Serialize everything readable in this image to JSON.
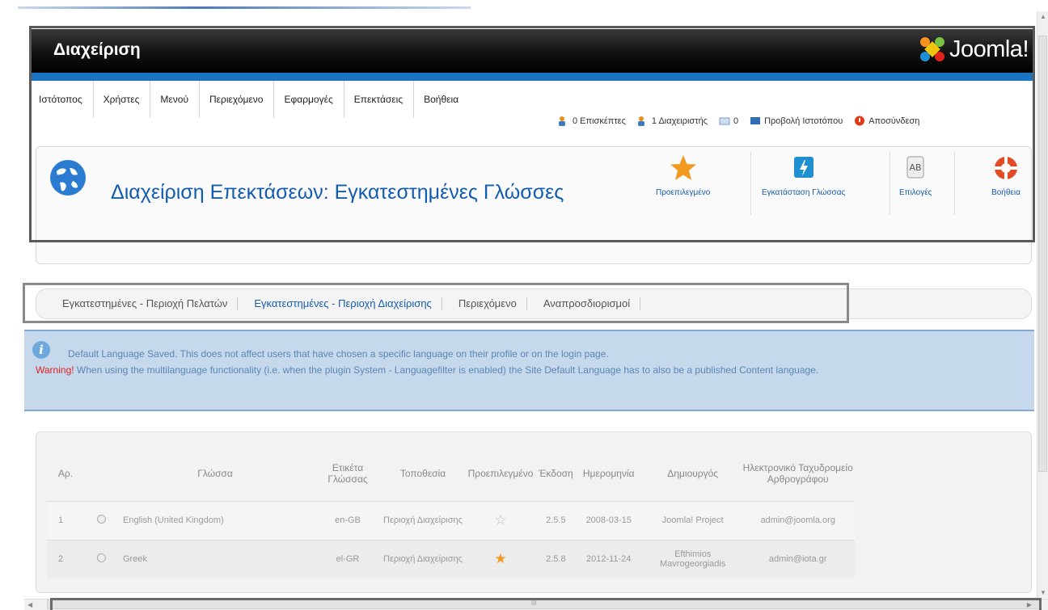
{
  "header": {
    "title": "Διαχείριση",
    "logo_text": "Joomla!"
  },
  "menu": {
    "items": [
      "Ιστότοπος",
      "Χρήστες",
      "Μενού",
      "Περιεχόμενο",
      "Εφαρμογές",
      "Επεκτάσεις",
      "Βοήθεια"
    ]
  },
  "status": {
    "visitors": "0 Επισκέπτες",
    "admins": "1 Διαχειριστής",
    "messages": "0",
    "view_site": "Προβολή Ιστοτόπου",
    "logout": "Αποσύνδεση"
  },
  "page": {
    "title": "Διαχείριση Επεκτάσεων: Εγκατεστημένες Γλώσσες"
  },
  "toolbar": {
    "default": "Προεπιλεγμένο",
    "install_language": "Εγκατάσταση Γλώσσας",
    "options": "Επιλογές",
    "help": "Βοήθεια"
  },
  "subtabs": {
    "items": [
      "Εγκατεστημένες - Περιοχή Πελατών",
      "Εγκατεστημένες - Περιοχή Διαχείρισης",
      "Περιεχόμενο",
      "Αναπροσδιορισμοί"
    ],
    "active_index": 1
  },
  "message": {
    "info": "Default Language Saved. This does not affect users that have chosen a specific language on their profile or on the login page.",
    "warning_label": "Warning!",
    "warning_text": "When using the multilanguage functionality (i.e. when the plugin System - Languagefilter is enabled) the Site Default Language has to also be a published Content language."
  },
  "table": {
    "headers": {
      "num": "Αρ.",
      "language": "Γλώσσα",
      "tag": "Ετικέτα Γλώσσας",
      "location": "Τοποθεσία",
      "default": "Προεπιλεγμένο",
      "version": "Έκδοση",
      "date": "Ημερομηνία",
      "author": "Δημιουργός",
      "email": "Ηλεκτρονικό Ταχυδρομείο Αρθρογράφου"
    },
    "rows": [
      {
        "num": "1",
        "language": "English (United Kingdom)",
        "tag": "en-GB",
        "location": "Περιοχή Διαχείρισης",
        "default": false,
        "version": "2.5.5",
        "date": "2008-03-15",
        "author": "Joomla! Project",
        "email": "admin@joomla.org"
      },
      {
        "num": "2",
        "language": "Greek",
        "tag": "el-GR",
        "location": "Περιοχή Διαχείρισης",
        "default": true,
        "version": "2.5.8",
        "date": "2012-11-24",
        "author": "Efthimios Mavrogeorgiadis",
        "email": "admin@iota.gr"
      }
    ]
  },
  "scrollbar": {
    "h_grip": "III"
  },
  "colors": {
    "accent": "#135cae",
    "header_bar": "#1a74c0",
    "message_bg": "#c6d8eb",
    "warning": "#dd2222",
    "star": "#f29a20"
  }
}
